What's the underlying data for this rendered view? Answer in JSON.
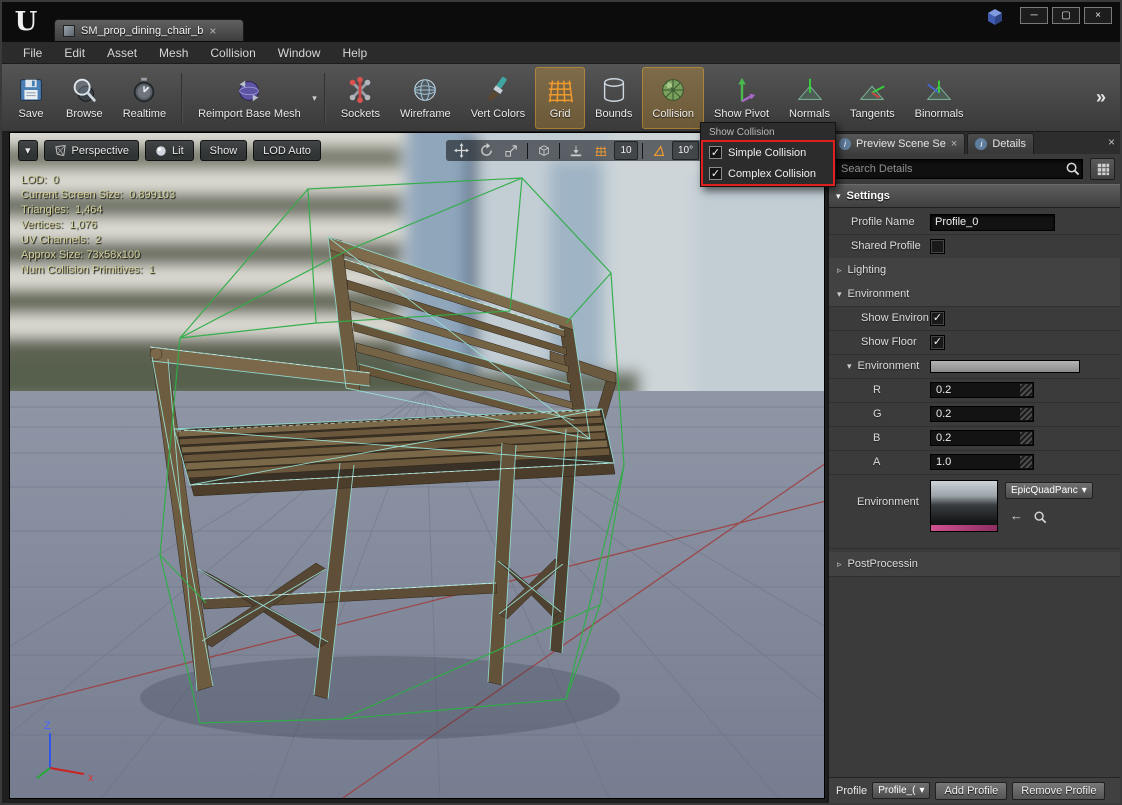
{
  "glyphs": {
    "logo": "U",
    "caret": "▾",
    "close": "×",
    "overflow": "»",
    "check": "✓",
    "back_arrow": "←",
    "min": "─",
    "max": "▢",
    "win_close": "×",
    "collapsed": "▹",
    "expanded": "▾",
    "info": "i"
  },
  "window": {
    "tab_title": "SM_prop_dining_chair_b"
  },
  "menu": {
    "items": [
      "File",
      "Edit",
      "Asset",
      "Mesh",
      "Collision",
      "Window",
      "Help"
    ]
  },
  "toolbar": {
    "buttons": [
      {
        "label": "Save"
      },
      {
        "label": "Browse"
      },
      {
        "label": "Realtime"
      },
      {
        "label": "Reimport Base Mesh"
      },
      {
        "label": "Sockets"
      },
      {
        "label": "Wireframe"
      },
      {
        "label": "Vert Colors"
      },
      {
        "label": "Grid"
      },
      {
        "label": "Bounds"
      },
      {
        "label": "Collision"
      },
      {
        "label": "Show Pivot"
      },
      {
        "label": "Normals"
      },
      {
        "label": "Tangents"
      },
      {
        "label": "Binormals"
      }
    ]
  },
  "collision_menu": {
    "header": "Show Collision",
    "items": [
      {
        "label": "Simple Collision",
        "check": "✓"
      },
      {
        "label": "Complex Collision",
        "check": "✓"
      }
    ]
  },
  "viewport": {
    "perspective": "Perspective",
    "lit": "Lit",
    "show": "Show",
    "lod": "LOD Auto",
    "grid_snap": "10",
    "angle_snap": "10°",
    "stats": [
      "LOD:  0",
      "Current Screen Size:  0.899103",
      "Triangles:  1,464",
      "Vertices:  1,076",
      "UV Channels:  2",
      "Approx Size: 73x58x100",
      "Num Collision Primitives:  1"
    ],
    "axis_z": "Z",
    "axis_x": "x"
  },
  "details": {
    "tab_preview": "Preview Scene Se",
    "tab_details": "Details",
    "search_placeholder": "Search Details",
    "settings": "Settings",
    "profile_name_label": "Profile Name",
    "profile_name_value": "Profile_0",
    "shared_profile_label": "Shared Profile",
    "lighting_label": "Lighting",
    "environment_label": "Environment",
    "show_environment_label": "Show Environ",
    "show_floor_label": "Show Floor",
    "env_color_label": "Environment",
    "r_label": "R",
    "r_value": "0.2",
    "g_label": "G",
    "g_value": "0.2",
    "b_label": "B",
    "b_value": "0.2",
    "a_label": "A",
    "a_value": "1.0",
    "cubemap_label": "Environment",
    "cubemap_value": "EpicQuadPanc",
    "postprocess_label": "PostProcessin"
  },
  "footer": {
    "profile_label": "Profile",
    "profile_dropdown": "Profile_(",
    "add_button": "Add Profile",
    "remove_button": "Remove Profile"
  }
}
